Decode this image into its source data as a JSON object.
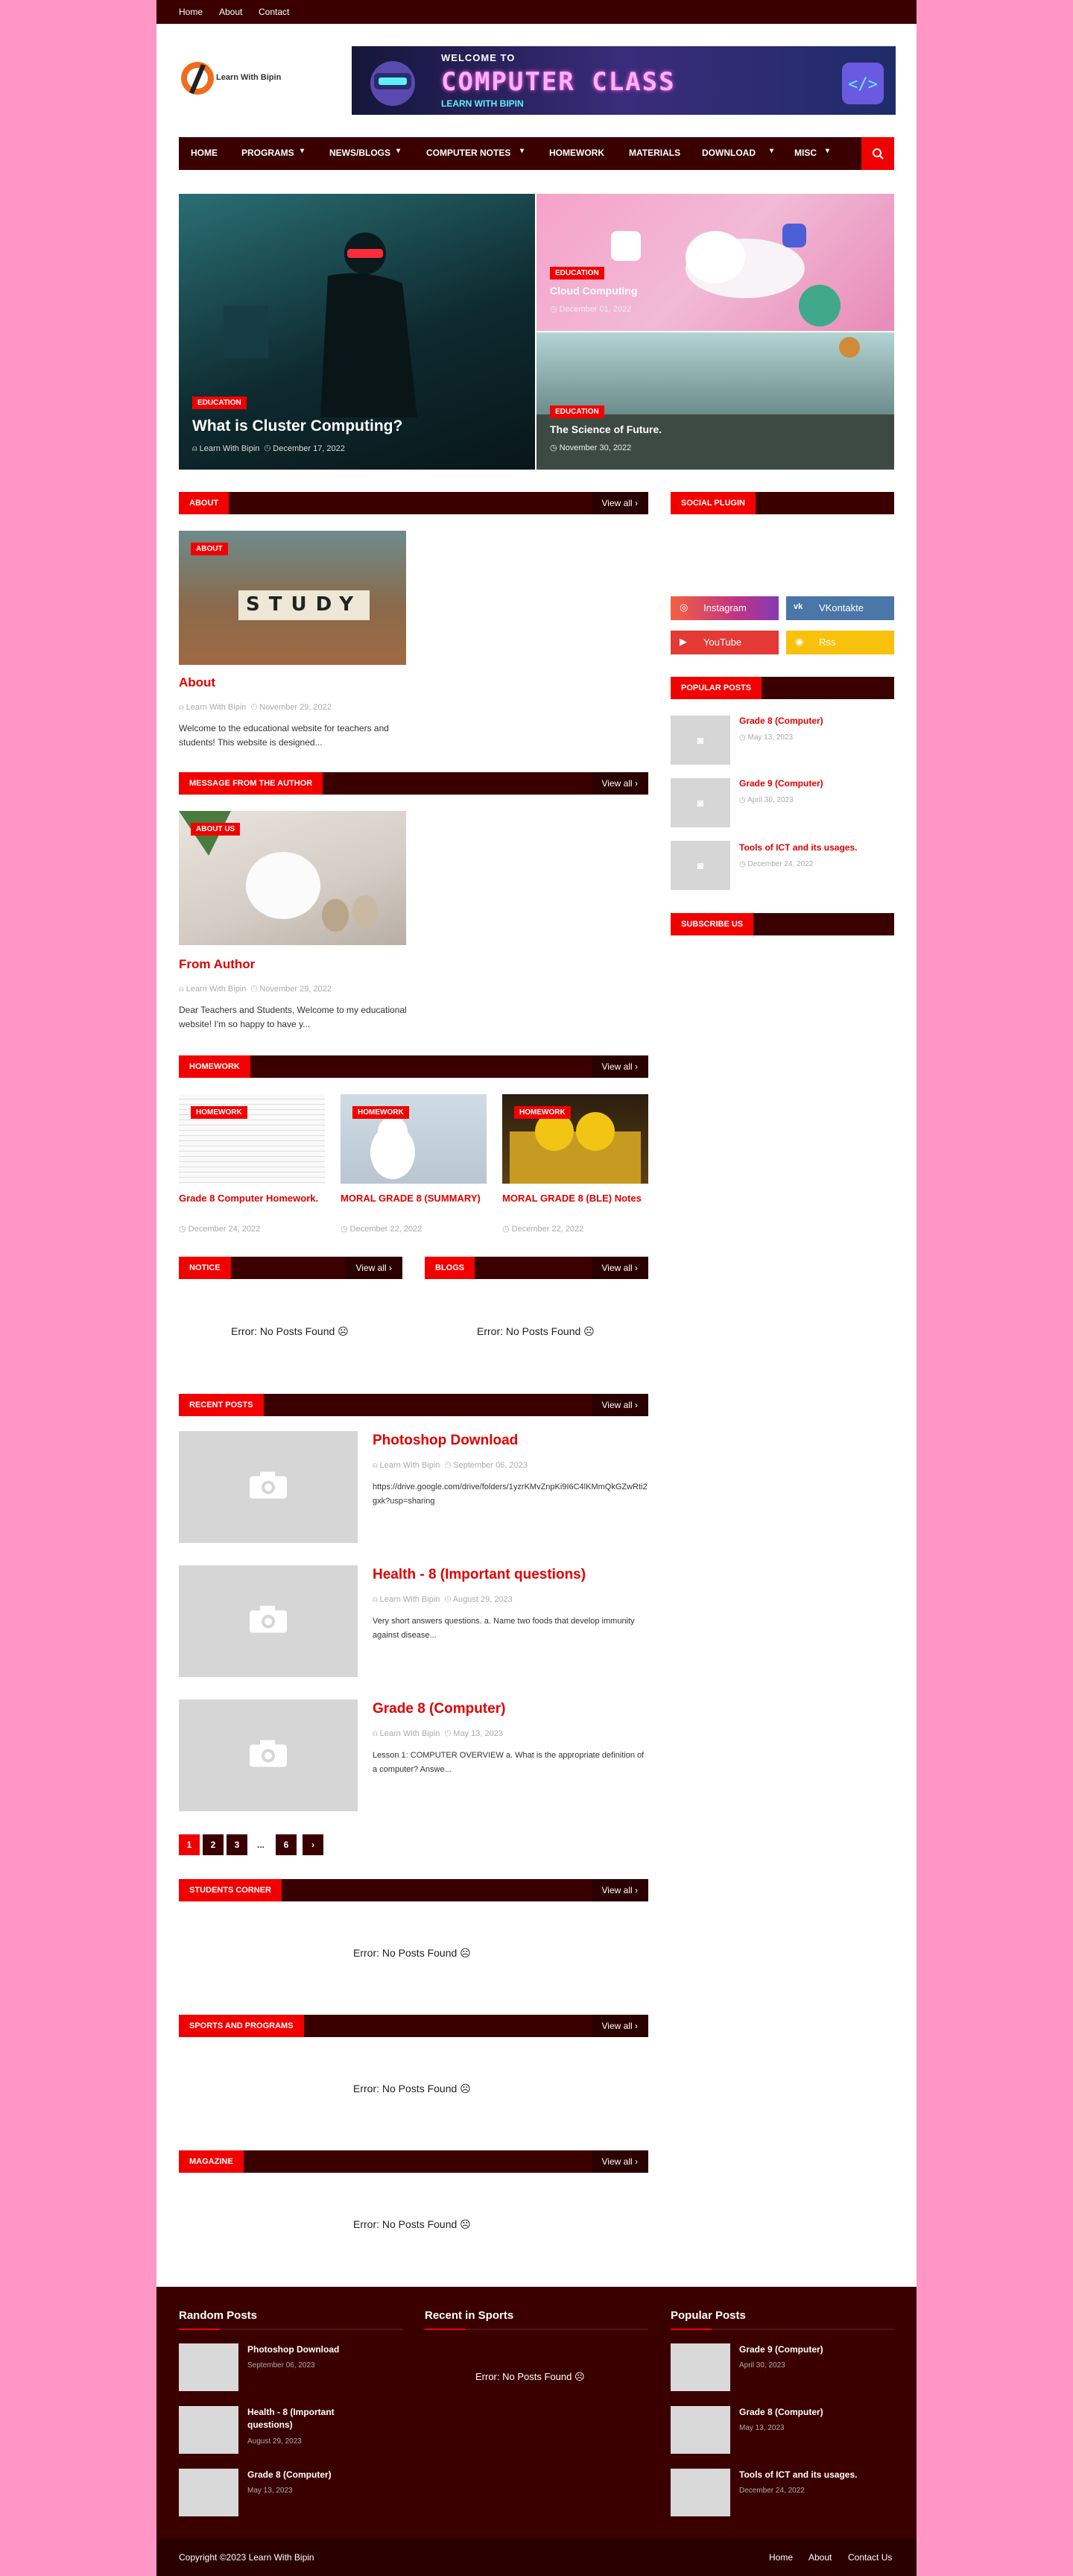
{
  "topbar": {
    "links": [
      "Home",
      "About",
      "Contact"
    ]
  },
  "header": {
    "logo_text": "Learn With Bipin",
    "banner": {
      "line1": "WELCOME TO",
      "line2": "COMPUTER CLASS",
      "line3": "LEARN WITH BIPIN"
    }
  },
  "nav": {
    "items": [
      "HOME",
      "PROGRAMS",
      "NEWS/BLOGS",
      "COMPUTER NOTES",
      "HOMEWORK",
      "MATERIALS",
      "DOWNLOAD",
      "MISC"
    ]
  },
  "featured": [
    {
      "label": "EDUCATION",
      "title": "What is Cluster Computing?",
      "author": "Learn With Bipin",
      "date": "December 17, 2022"
    },
    {
      "label": "EDUCATION",
      "title": "Cloud Computing",
      "date": "December 01, 2022"
    },
    {
      "label": "EDUCATION",
      "title": "The Science of Future.",
      "date": "November 30, 2022"
    }
  ],
  "about": {
    "section": "ABOUT",
    "view_all": "View all",
    "badge": "ABOUT",
    "image_text": "STUDY",
    "title": "About",
    "author": "Learn With Bipin",
    "date": "November 29, 2022",
    "excerpt": "Welcome to the educational website for teachers and students! This website is designed..."
  },
  "author_msg": {
    "section": "MESSAGE FROM THE AUTHOR",
    "view_all": "View all",
    "badge": "ABOUT US",
    "title": "From Author",
    "author": "Learn With Bipin",
    "date": "November 29, 2022",
    "excerpt": "Dear Teachers and Students, Welcome to my educational website! I'm so happy to have y..."
  },
  "homework": {
    "section": "HOMEWORK",
    "view_all": "View all",
    "posts": [
      {
        "badge": "HOMEWORK",
        "title": "Grade 8 Computer Homework.",
        "date": "December 24, 2022"
      },
      {
        "badge": "HOMEWORK",
        "title": "MORAL GRADE 8 (SUMMARY)",
        "date": "December 22, 2022"
      },
      {
        "badge": "HOMEWORK",
        "title": "MORAL GRADE 8 (BLE) Notes",
        "date": "December 22, 2022"
      }
    ]
  },
  "notice": {
    "section": "NOTICE",
    "view_all": "View all",
    "error": "Error: No Posts Found ☹"
  },
  "blogs": {
    "section": "BLOGS",
    "view_all": "View all",
    "error": "Error: No Posts Found ☹"
  },
  "recent": {
    "section": "RECENT POSTS",
    "view_all": "View all",
    "posts": [
      {
        "title": "Photoshop Download",
        "author": "Learn With Bipin",
        "date": "September 06, 2023",
        "excerpt": "https://drive.google.com/drive/folders/1yzrKMvZnpKi9I6C4lKMmQkGZwRti2gxk?usp=sharing"
      },
      {
        "title": "Health - 8 (Important questions)",
        "author": "Learn With Bipin",
        "date": "August 29, 2023",
        "excerpt": "Very short answers questions.  a. Name two foods that develop immunity against disease..."
      },
      {
        "title": "Grade 8 (Computer)",
        "author": "Learn With Bipin",
        "date": "May 13, 2023",
        "excerpt": "Lesson 1: COMPUTER OVERVIEW a. What is the appropriate definition of a computer? Answe..."
      }
    ],
    "pagination": [
      "1",
      "2",
      "3",
      "...",
      "6",
      "›"
    ]
  },
  "students": {
    "section": "STUDENTS CORNER",
    "view_all": "View all",
    "error": "Error: No Posts Found ☹"
  },
  "sports": {
    "section": "SPORTS AND PROGRAMS",
    "view_all": "View all",
    "error": "Error: No Posts Found ☹"
  },
  "magazine": {
    "section": "MAGAZINE",
    "view_all": "View all",
    "error": "Error: No Posts Found ☹"
  },
  "sidebar": {
    "social": {
      "section": "SOCIAL PLUGIN",
      "items": [
        "Instagram",
        "VKontakte",
        "YouTube",
        "Rss"
      ]
    },
    "popular": {
      "section": "POPULAR POSTS",
      "posts": [
        {
          "title": "Grade 8 (Computer)",
          "date": "May 13, 2023"
        },
        {
          "title": "Grade 9 (Computer)",
          "date": "April 30, 2023"
        },
        {
          "title": "Tools of ICT and its usages.",
          "date": "December 24, 2022"
        }
      ]
    },
    "subscribe": {
      "section": "SUBSCRIBE US"
    }
  },
  "footer": {
    "random": {
      "heading": "Random Posts",
      "posts": [
        {
          "title": "Photoshop Download",
          "date": "September 06, 2023"
        },
        {
          "title": "Health - 8 (Important questions)",
          "date": "August 29, 2023"
        },
        {
          "title": "Grade 8 (Computer)",
          "date": "May 13, 2023"
        }
      ]
    },
    "sports": {
      "heading": "Recent in Sports",
      "error": "Error: No Posts Found ☹"
    },
    "popular": {
      "heading": "Popular Posts",
      "posts": [
        {
          "title": "Grade 9 (Computer)",
          "date": "April 30, 2023"
        },
        {
          "title": "Grade 8 (Computer)",
          "date": "May 13, 2023"
        },
        {
          "title": "Tools of ICT and its usages.",
          "date": "December 24, 2022"
        }
      ]
    },
    "copyright": "Copyright ©2023 Learn With Bipin",
    "links": [
      "Home",
      "About",
      "Contact Us"
    ]
  },
  "colors": {
    "primary": "#f20000",
    "dark": "#3a0000",
    "page_bg": "#ff96c6"
  }
}
